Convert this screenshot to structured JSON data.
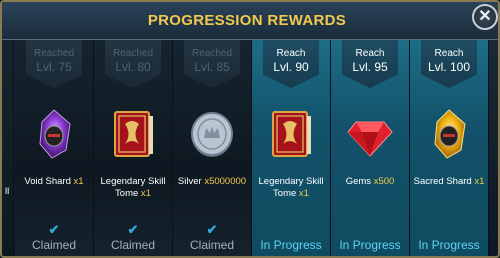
{
  "window": {
    "title": "PROGRESSION REWARDS",
    "close_label": "✕"
  },
  "partial_card": {
    "label": "ll"
  },
  "cards": [
    {
      "state": "Reached",
      "level": "Lvl. 75",
      "name": "Void Shard",
      "qty": "x1",
      "status": "Claimed",
      "icon": "void-shard-icon",
      "claimed": true
    },
    {
      "state": "Reached",
      "level": "Lvl. 80",
      "name": "Legendary Skill Tome",
      "qty": "x1",
      "status": "Claimed",
      "icon": "legendary-skill-tome-icon",
      "claimed": true
    },
    {
      "state": "Reached",
      "level": "Lvl. 85",
      "name": "Silver",
      "qty": "x5000000",
      "status": "Claimed",
      "icon": "silver-coin-icon",
      "claimed": true
    },
    {
      "state": "Reach",
      "level": "Lvl. 90",
      "name": "Legendary Skill Tome",
      "qty": "x1",
      "status": "In Progress",
      "icon": "legendary-skill-tome-icon",
      "claimed": false
    },
    {
      "state": "Reach",
      "level": "Lvl. 95",
      "name": "Gems",
      "qty": "x500",
      "status": "In Progress",
      "icon": "gem-icon",
      "claimed": false
    },
    {
      "state": "Reach",
      "level": "Lvl. 100",
      "name": "Sacred Shard",
      "qty": "x1",
      "status": "In Progress",
      "icon": "sacred-shard-icon",
      "claimed": false
    }
  ],
  "colors": {
    "accent_title": "#f2c94c",
    "in_progress": "#5fd3f3",
    "claimed_text": "#a6b0b8",
    "check": "#38a6d8"
  }
}
